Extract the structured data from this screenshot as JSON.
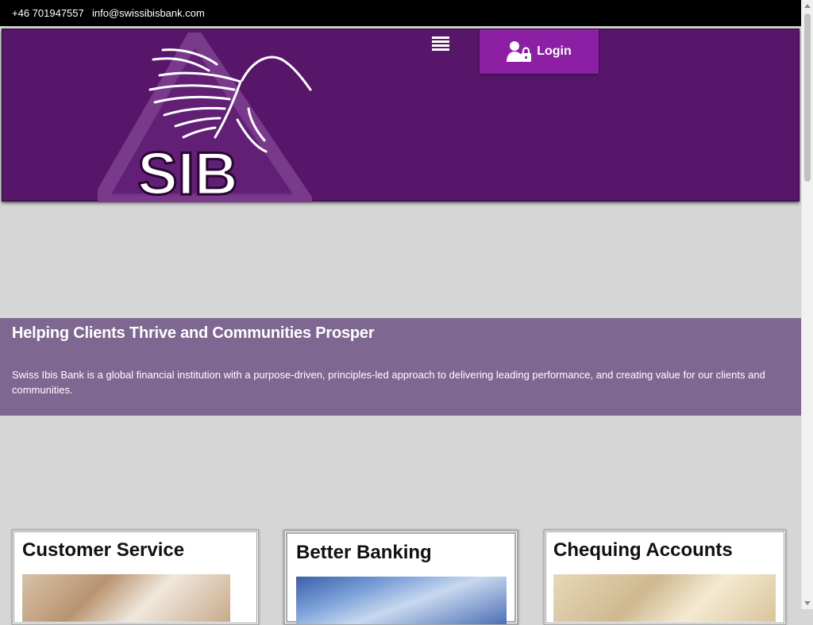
{
  "topbar": {
    "phone": "+46 701947557",
    "email": "info@swissibisbank.com"
  },
  "header": {
    "logo": {
      "text": "SIB",
      "icon": "ibis-bird-triangle-logo"
    },
    "menu_icon": "hamburger-menu-icon",
    "login": {
      "label": "Login",
      "icon": "user-lock-icon"
    }
  },
  "hero": {
    "title": "Helping Clients Thrive and Communities Prosper",
    "text": "Swiss Ibis Bank is a global financial institution with a purpose-driven, principles-led approach to delivering leading performance, and creating value for our clients and communities."
  },
  "cards": [
    {
      "title": "Customer Service"
    },
    {
      "title": "Better Banking"
    },
    {
      "title": "Chequing Accounts"
    }
  ],
  "colors": {
    "topbar": "#000000",
    "header": "#57166a",
    "login_button": "#8c1fa3",
    "hero_band": "#7e6791",
    "page_background": "#d6d6d6"
  }
}
